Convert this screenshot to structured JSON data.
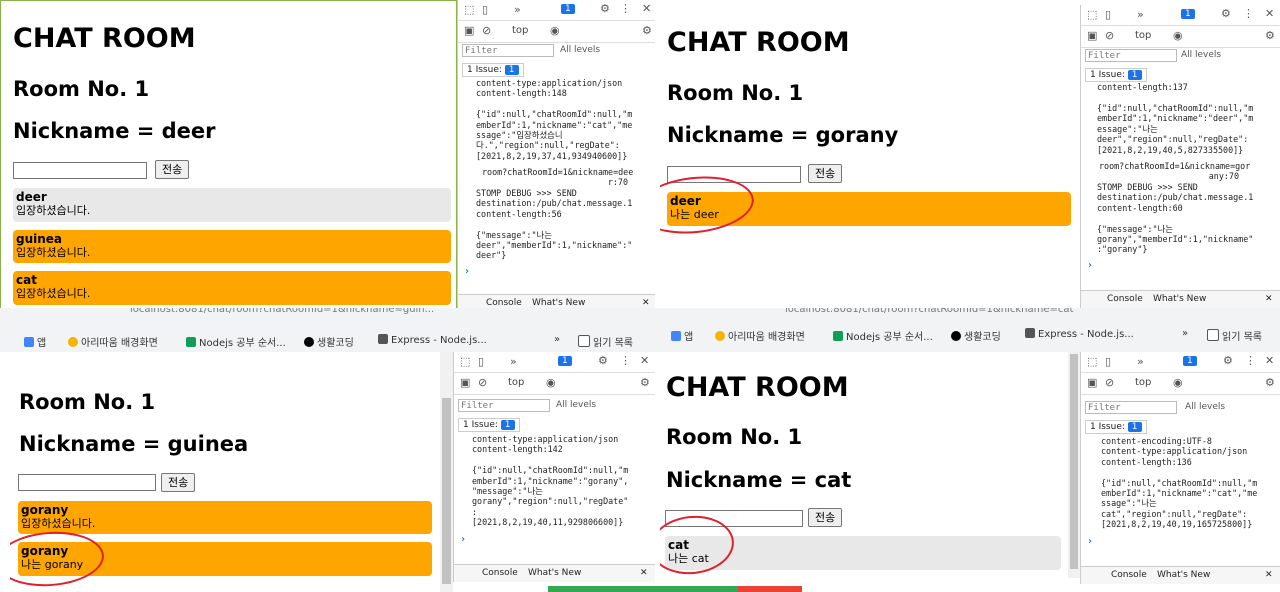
{
  "common": {
    "title": "CHAT ROOM",
    "room": "Room No. 1",
    "send_label": "전송",
    "dt_top": "top",
    "dt_filter": "Filter",
    "dt_levels": "All levels",
    "dt_issue": "1 Issue:",
    "dt_issue_count": "1",
    "dt_badge": "1",
    "tab_console": "Console",
    "tab_whatsnew": "What's New"
  },
  "bookmarks": {
    "apps": "앱",
    "b1": "아리따움 배경화면",
    "b2": "Nodejs 공부 순서...",
    "b3": "생활코딩",
    "b4": "Express - Node.js...",
    "reading": "읽기 목록",
    "url_left": "localhost:8081/chat/room?chatRoomId=1&nickname=guin...",
    "url_right": "localhost:8081/chat/room?chatRoomId=1&nickname=cat"
  },
  "pane_deer": {
    "nickname": "Nickname = deer",
    "messages": [
      {
        "nick": "deer",
        "text": "입장하셨습니다."
      },
      {
        "nick": "guinea",
        "text": "입장하셨습니다."
      },
      {
        "nick": "cat",
        "text": "입장하셨습니다."
      }
    ],
    "log1": "content-type:application/json\ncontent-length:148\n\n{\"id\":null,\"chatRoomId\":null,\"m\nemberId\":1,\"nickname\":\"cat\",\"me\nssage\":\"입장하셨습니\n다.\",\"region\":null,\"regDate\":\n[2021,8,2,19,37,41,934940600]}",
    "link": "room?chatRoomId=1&nickname=dee\nr:70",
    "log2": "STOMP DEBUG >>> SEND\ndestination:/pub/chat.message.1\ncontent-length:56\n\n{\"message\":\"나는\ndeer\",\"memberId\":1,\"nickname\":\"\ndeer\"}"
  },
  "pane_gorany": {
    "nickname": "Nickname = gorany",
    "messages": [
      {
        "nick": "deer",
        "text": "나는 deer"
      }
    ],
    "log0": "content-length:137",
    "log1": "{\"id\":null,\"chatRoomId\":null,\"m\nemberId\":1,\"nickname\":\"deer\",\"m\nessage\":\"나는\ndeer\",\"region\":null,\"regDate\":\n[2021,8,2,19,40,5,827335500]}",
    "link": "room?chatRoomId=1&nickname=gor\nany:70",
    "log2": "STOMP DEBUG >>> SEND\ndestination:/pub/chat.message.1\ncontent-length:60\n\n{\"message\":\"나는\ngorany\",\"memberId\":1,\"nickname\"\n:\"gorany\"}"
  },
  "pane_guinea": {
    "nickname": "Nickname = guinea",
    "messages": [
      {
        "nick": "gorany",
        "text": "입장하셨습니다."
      },
      {
        "nick": "gorany",
        "text": "나는 gorany"
      }
    ],
    "log1": "content-type:application/json\ncontent-length:142\n\n{\"id\":null,\"chatRoomId\":null,\"m\nemberId\":1,\"nickname\":\"gorany\",\n\"message\":\"나는\ngorany\",\"region\":null,\"regDate\"\n:\n[2021,8,2,19,40,11,929806600]}"
  },
  "pane_cat": {
    "nickname": "Nickname = cat",
    "messages": [
      {
        "nick": "cat",
        "text": "나는 cat"
      }
    ],
    "log1": "content-encoding:UTF-8\ncontent-type:application/json\ncontent-length:136\n\n{\"id\":null,\"chatRoomId\":null,\"m\nemberId\":1,\"nickname\":\"cat\",\"me\nssage\":\"나는\ncat\",\"region\":null,\"regDate\":\n[2021,8,2,19,40,19,165725800]}"
  }
}
